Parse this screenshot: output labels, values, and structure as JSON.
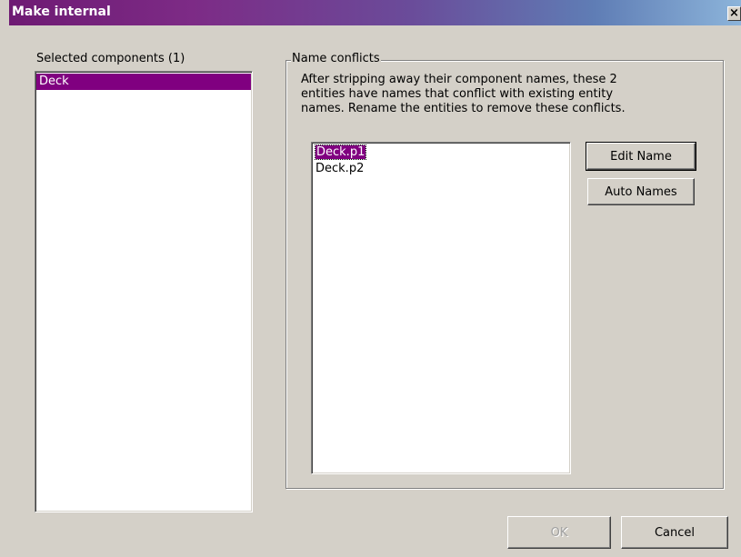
{
  "window": {
    "title": "Make internal",
    "close_glyph": "×"
  },
  "selected_components": {
    "label": "Selected components (1)",
    "items": [
      "Deck"
    ]
  },
  "name_conflicts": {
    "legend": "Name conflicts",
    "description_lines": [
      "After stripping away their component names, these 2",
      "entities have names that conflict with existing entity",
      "names. Rename the entities to remove these conflicts."
    ],
    "items": [
      "Deck.p1",
      "Deck.p2"
    ],
    "edit_name_label": "Edit Name",
    "auto_names_label": "Auto Names"
  },
  "footer": {
    "ok_label": "OK",
    "cancel_label": "Cancel"
  },
  "colors": {
    "selection": "#800080",
    "dialog_bg": "#d4d0c8"
  }
}
